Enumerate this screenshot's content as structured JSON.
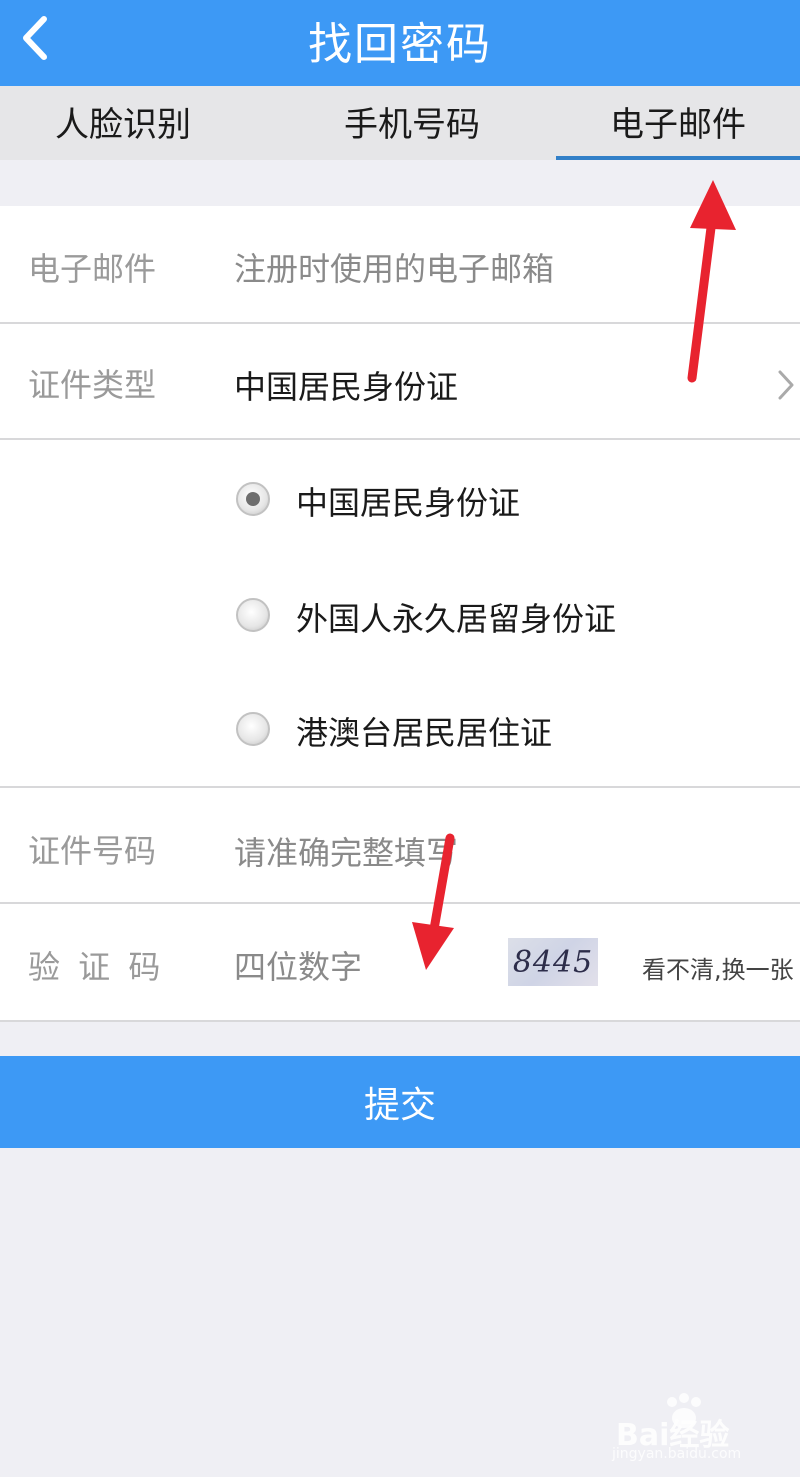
{
  "header": {
    "title": "找回密码"
  },
  "tabs": [
    {
      "label": "人脸识别",
      "active": false
    },
    {
      "label": "手机号码",
      "active": false
    },
    {
      "label": "电子邮件",
      "active": true
    }
  ],
  "form": {
    "email": {
      "label": "电子邮件",
      "placeholder": "注册时使用的电子邮箱"
    },
    "id_type": {
      "label": "证件类型",
      "value": "中国居民身份证"
    },
    "id_options": [
      {
        "label": "中国居民身份证",
        "checked": true
      },
      {
        "label": "外国人永久居留身份证",
        "checked": false
      },
      {
        "label": "港澳台居民居住证",
        "checked": false
      }
    ],
    "id_number": {
      "label": "证件号码",
      "placeholder": "请准确完整填写"
    },
    "captcha": {
      "label": "验 证 码",
      "placeholder": "四位数字",
      "image_text": "8445",
      "refresh_label": "看不清,换一张"
    }
  },
  "submit_label": "提交",
  "watermark": {
    "brand": "Bai经验",
    "url": "jingyan.baidu.com"
  },
  "colors": {
    "accent": "#3d99f5",
    "tab_underline": "#3280c8",
    "annotation_arrow": "#e8232f"
  },
  "icons": [
    "back-arrow-icon",
    "chevron-right-icon",
    "radio-icon",
    "annotation-arrow-icon",
    "baidu-paw-icon"
  ]
}
